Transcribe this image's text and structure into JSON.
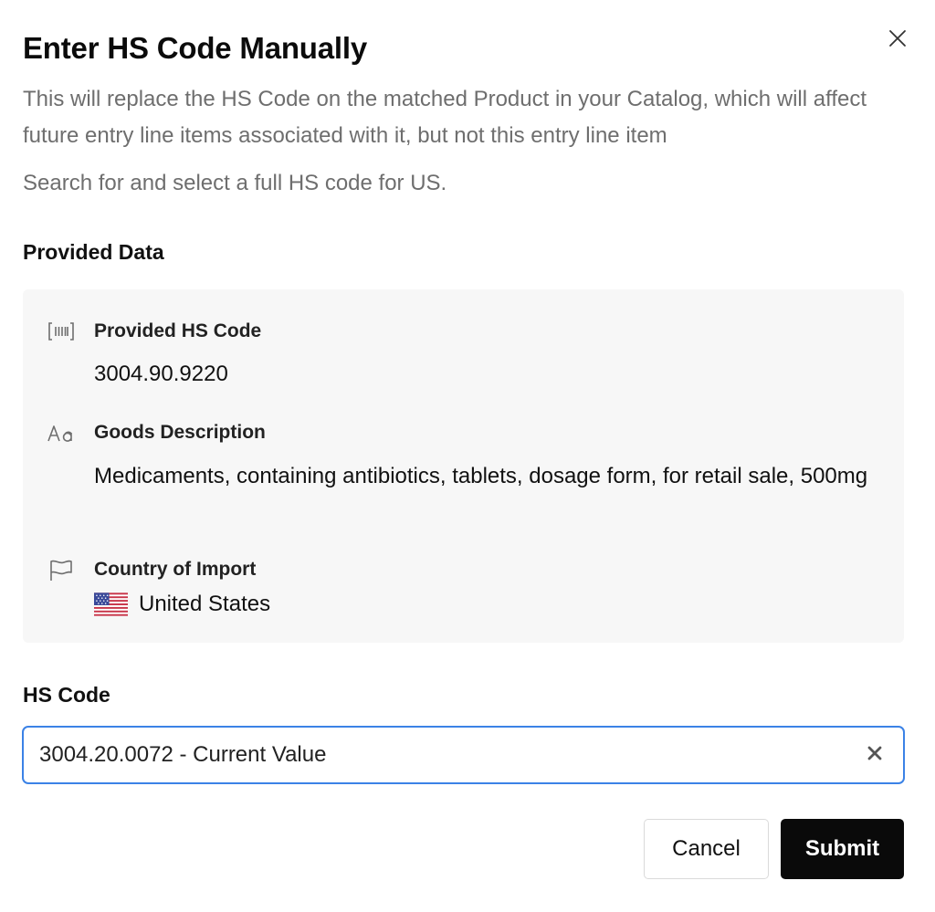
{
  "modal": {
    "title": "Enter HS Code Manually",
    "description": "This will replace the HS Code on the matched Product in your Catalog, which will affect future entry line items associated with it, but not this entry line item",
    "hint": "Search for and select a full HS code for US.",
    "close_icon": "close-icon"
  },
  "provided_data": {
    "section_title": "Provided Data",
    "hs_code": {
      "icon": "barcode-icon",
      "label": "Provided HS Code",
      "value": "3004.90.9220"
    },
    "goods_description": {
      "icon": "text-type-icon",
      "label": "Goods Description",
      "value": "Medicaments, containing antibiotics, tablets, dosage form, for retail sale, 500mg"
    },
    "country_of_import": {
      "icon": "flag-icon",
      "label": "Country of Import",
      "value": "United States",
      "flag": "us-flag-icon"
    }
  },
  "hs_code_field": {
    "label": "HS Code",
    "value": "3004.20.0072 - Current Value",
    "clear_icon": "clear-icon"
  },
  "actions": {
    "cancel_label": "Cancel",
    "submit_label": "Submit"
  },
  "colors": {
    "focus_border": "#3b82e6",
    "panel_bg": "#f7f7f7",
    "primary_button": "#0a0a0a",
    "muted_text": "#6e6e6e"
  }
}
